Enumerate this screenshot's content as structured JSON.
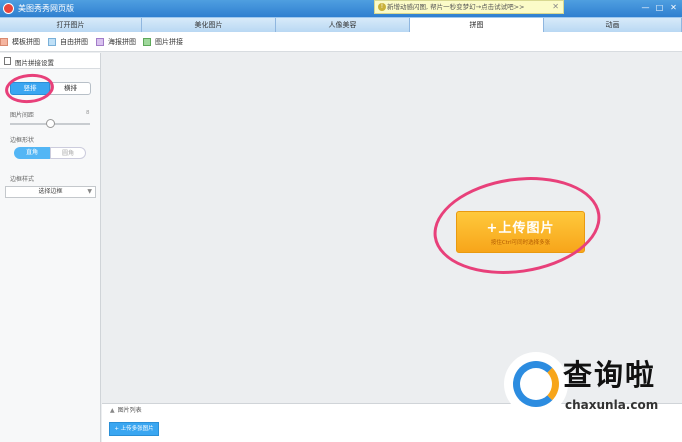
{
  "window": {
    "title": "美图秀秀网页版"
  },
  "notice": {
    "text": "新增动感闪图, 帮片一秒变梦幻→点击试试吧>>",
    "close": "✕"
  },
  "window_controls": {
    "minimize": "—",
    "maximize": "□",
    "close": "✕"
  },
  "tabs": [
    {
      "label": "打开图片"
    },
    {
      "label": "美化图片"
    },
    {
      "label": "人像美容"
    },
    {
      "label": "拼图"
    },
    {
      "label": "动画"
    }
  ],
  "toolbar": {
    "template": "模板拼图",
    "free": "自由拼图",
    "poster": "海报拼图",
    "stitch": "图片拼接"
  },
  "panel": {
    "title": "图片拼接设置",
    "vertical": "竖排",
    "horizontal": "横排",
    "spacing_label": "图片间距",
    "spacing_value": "8",
    "corner_label": "边框形状",
    "corner_square": "直角",
    "corner_round": "圆角",
    "style_label": "边框样式",
    "style_select": "选择边框"
  },
  "canvas": {
    "upload_label": "+上传图片",
    "upload_hint": "按住Ctrl可同时选择多张"
  },
  "strip": {
    "title": "图片列表",
    "add_label": "+ 上传多张图片"
  },
  "watermark": {
    "name": "查询啦",
    "url": "chaxunla.com"
  },
  "colors": {
    "accent": "#3aa6f1",
    "upload": "#f7a51a",
    "annotation": "#e8407a"
  }
}
